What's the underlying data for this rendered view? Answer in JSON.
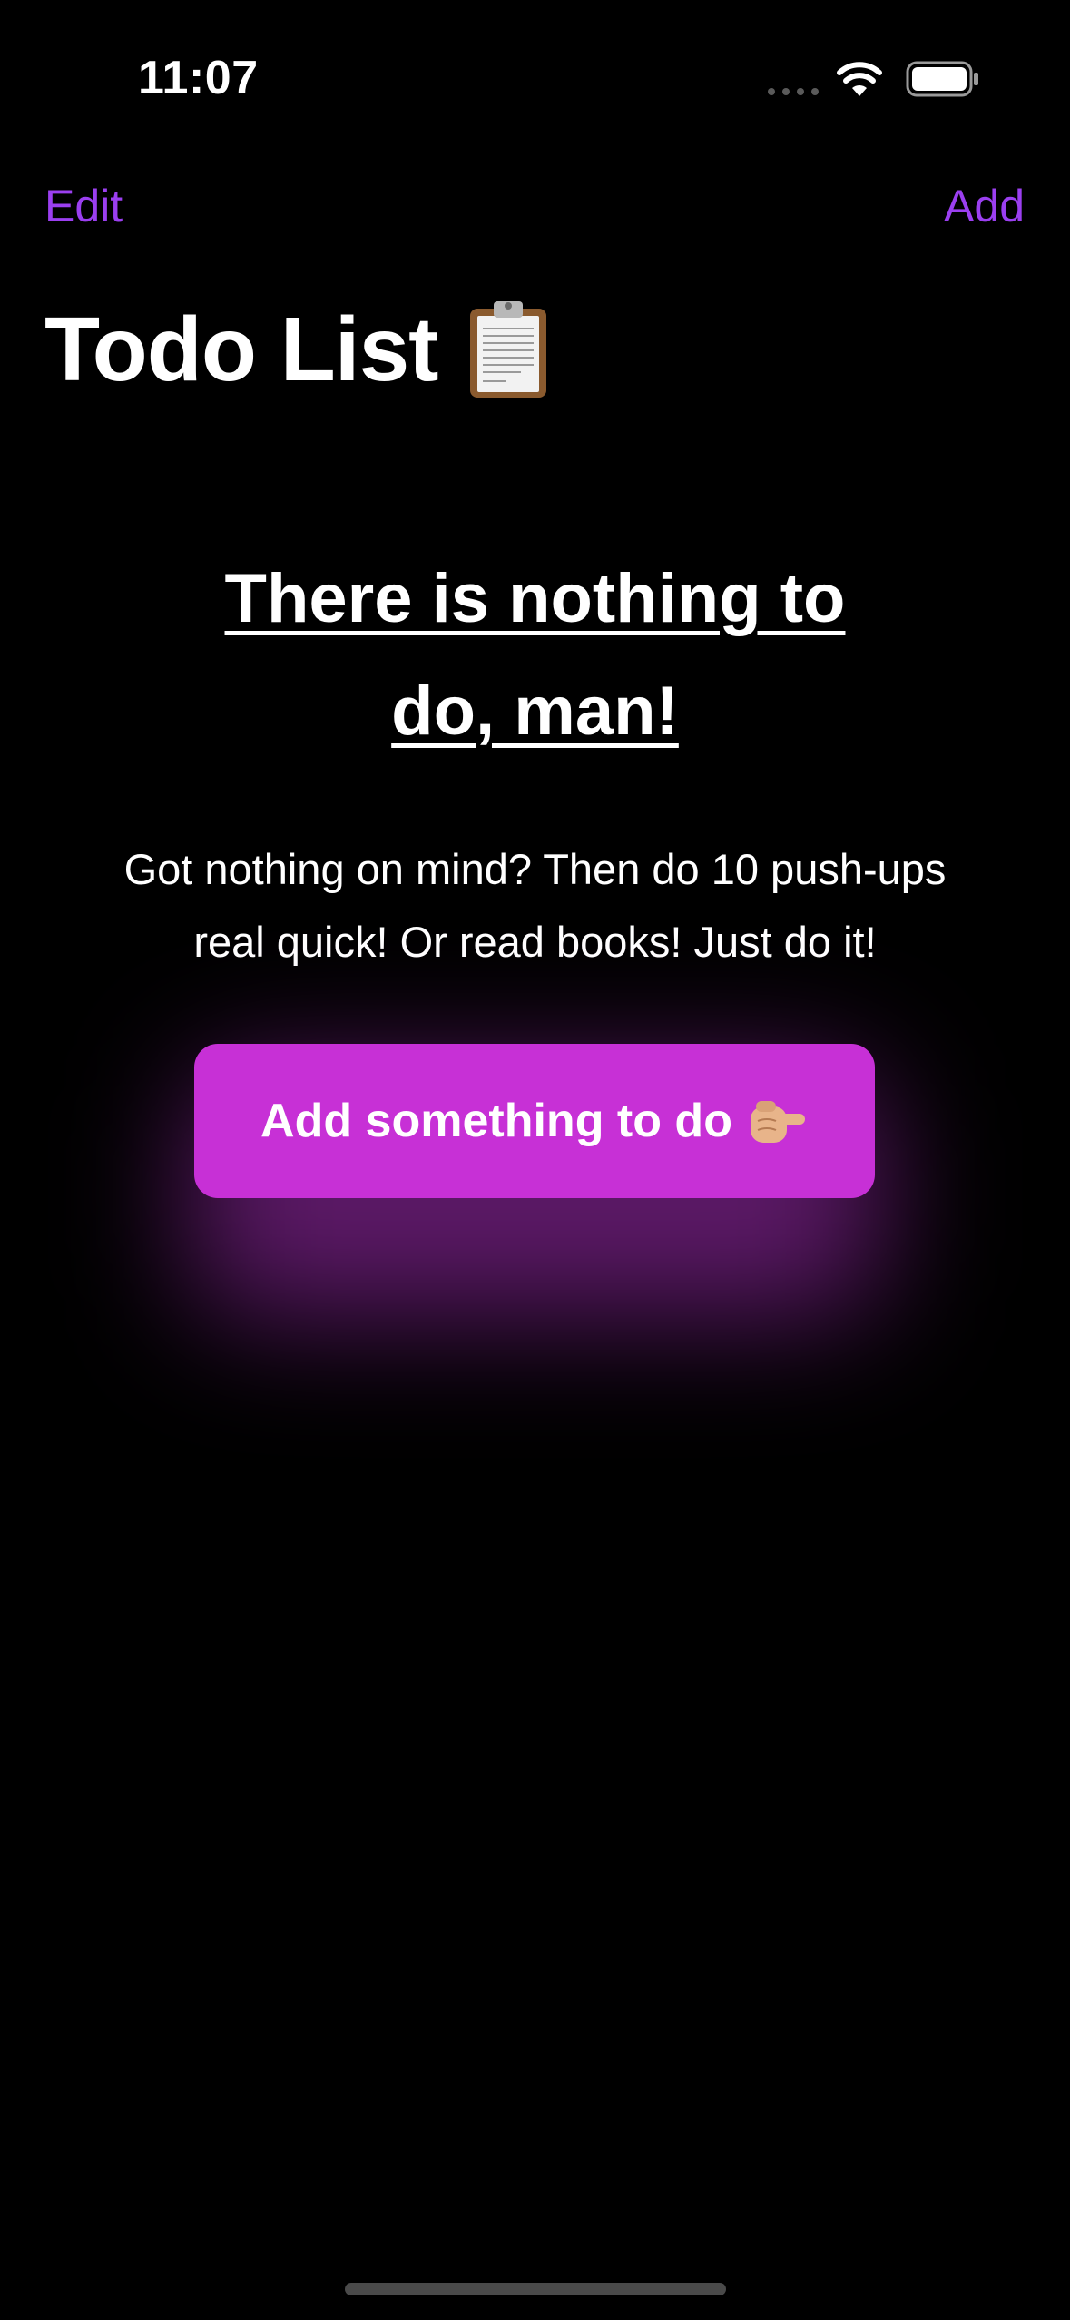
{
  "status_bar": {
    "time": "11:07",
    "icons": [
      "signal-dots-icon",
      "wifi-icon",
      "battery-icon"
    ]
  },
  "nav": {
    "edit_label": "Edit",
    "add_label": "Add",
    "accent_color": "#9b3ff0"
  },
  "header": {
    "title": "Todo List",
    "title_icon": "clipboard-icon"
  },
  "empty_state": {
    "heading": "There is nothing to do, man!",
    "body": "Got nothing on mind? Then do 10 push-ups real quick! Or read books! Just do it!",
    "button_label": "Add something to do",
    "button_icon": "pointing-hand-icon",
    "button_color": "#c730d6"
  },
  "colors": {
    "background": "#000000",
    "text": "#ffffff"
  }
}
